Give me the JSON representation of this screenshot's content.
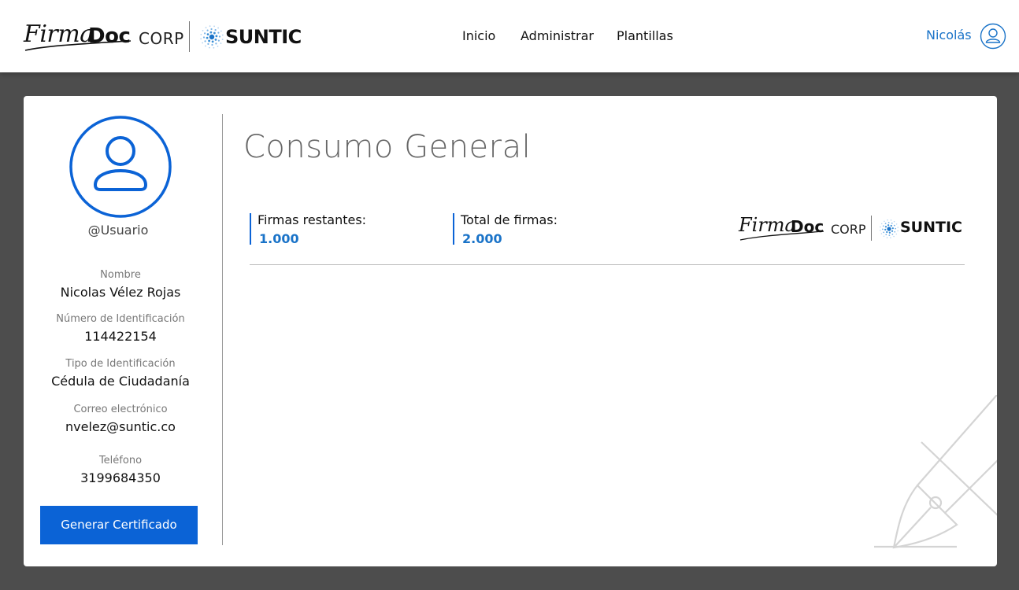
{
  "header": {
    "logo": {
      "firma": "Firma",
      "doc": "Doc",
      "corp": "CORP",
      "partner": "SUNTIC"
    },
    "nav": [
      "Inicio",
      "Administrar",
      "Plantillas"
    ],
    "user_name": "Nicolás"
  },
  "profile": {
    "username": "@Usuario",
    "fields": [
      {
        "label": "Nombre",
        "value": "Nicolas Vélez Rojas"
      },
      {
        "label": "Número de Identificación",
        "value": "114422154"
      },
      {
        "label": "Tipo de Identificación",
        "value": "Cédula de Ciudadanía"
      },
      {
        "label": "Correo electrónico",
        "value": "nvelez@suntic.co"
      },
      {
        "label": "Teléfono",
        "value": "3199684350"
      }
    ],
    "button_label": "Generar Certificado"
  },
  "main": {
    "title": "Consumo General",
    "stats": [
      {
        "label": "Firmas restantes:",
        "value": "1.000"
      },
      {
        "label": "Total de firmas:",
        "value": "2.000"
      }
    ]
  },
  "colors": {
    "accent": "#0b63d6",
    "link": "#1a73c8",
    "backdrop": "#4d4d4d",
    "card": "#ffffff"
  },
  "icons": {
    "user": "user-circle-icon",
    "avatar": "user-avatar-icon",
    "watermark": "fountain-pen-icon",
    "brand_mark": "suntic-dots-icon"
  }
}
